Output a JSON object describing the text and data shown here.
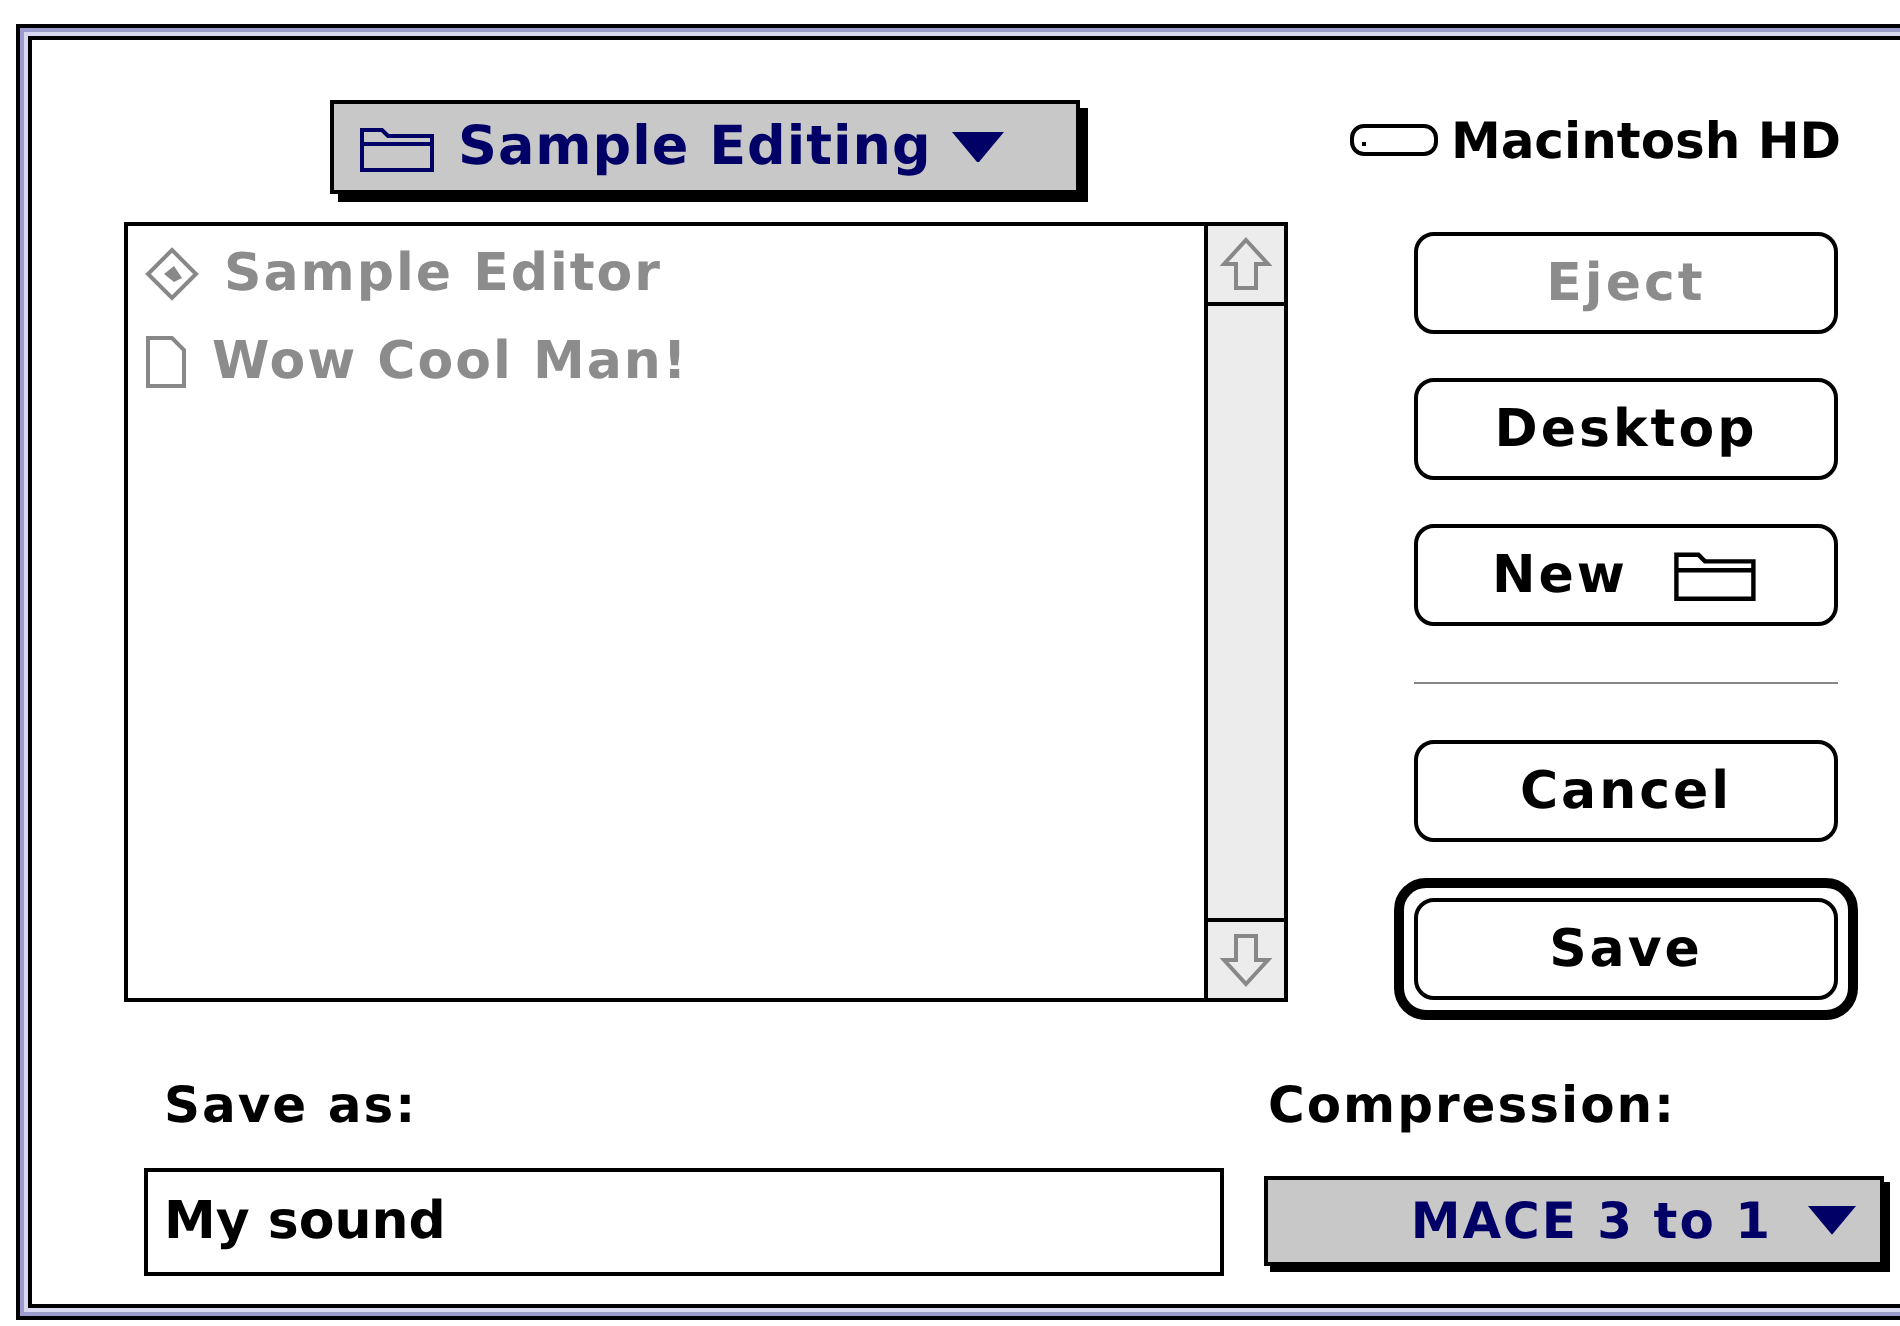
{
  "location_popup": {
    "label": "Sample Editing"
  },
  "files": [
    {
      "name": "Sample Editor",
      "kind": "application",
      "disabled": true
    },
    {
      "name": "Wow Cool Man!",
      "kind": "document",
      "disabled": true
    }
  ],
  "disk": {
    "name": "Macintosh HD"
  },
  "navigation_buttons": [
    {
      "label": "Eject",
      "kind": "plain",
      "disabled": true
    },
    {
      "label": "Desktop",
      "kind": "plain",
      "disabled": false
    },
    {
      "label": "New",
      "kind": "new-folder",
      "disabled": false
    }
  ],
  "action_buttons": [
    {
      "label": "Cancel",
      "default": false
    },
    {
      "label": "Save",
      "default": true
    }
  ],
  "save_as": {
    "label": "Save as:",
    "value": "My sound"
  },
  "compression": {
    "label": "Compression:",
    "value": "MACE 3 to 1"
  }
}
